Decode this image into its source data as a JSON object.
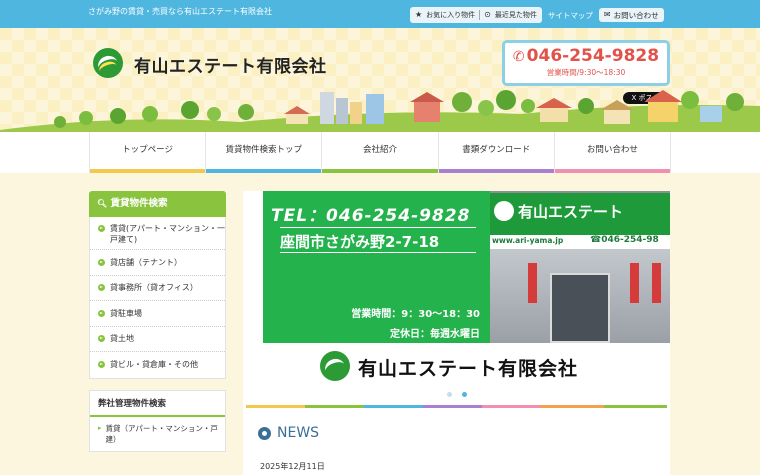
{
  "topbar": {
    "tagline": "さがみ野の賃貸・売買なら有山エステート有限会社",
    "favorites": "お気に入り物件",
    "recent": "最近見た物件",
    "sitemap": "サイトマップ",
    "contact": "お問い合わせ"
  },
  "header": {
    "company": "有山エステート有限会社",
    "phone": "046-254-9828",
    "hours": "営業時間/9:30〜18:30",
    "post_button": "X ポスト"
  },
  "nav": {
    "items": [
      {
        "label": "トップページ",
        "color": "#f2c94c"
      },
      {
        "label": "賃貸物件検索トップ",
        "color": "#4fb6e0"
      },
      {
        "label": "会社紹介",
        "color": "#8ac43f"
      },
      {
        "label": "書類ダウンロード",
        "color": "#a97fd0"
      },
      {
        "label": "お問い合わせ",
        "color": "#f08fb0"
      }
    ]
  },
  "sidebar": {
    "search_title": "賃貸物件検索",
    "items": [
      "賃貸(アパート・マンション・一戸建て)",
      "貸店舗（テナント）",
      "貸事務所（貸オフィス）",
      "貸駐車場",
      "貸土地",
      "貸ビル・貸倉庫・その他"
    ],
    "managed_title": "弊社管理物件検索",
    "managed_items": [
      "賃貸（アパート・マンション・戸建）"
    ]
  },
  "slide": {
    "tel": "TEL：046-254-9828",
    "address": "座間市さがみ野2-7-18",
    "hours": "営業時間：9：30〜18：30",
    "closed": "定休日：毎週水曜日",
    "sign_text": "有山エステート",
    "sign_url": "www.ari-yama.jp",
    "sign_tel": "☎046-254-98",
    "company": "有山エステート有限会社"
  },
  "news": {
    "title": "NEWS",
    "date": "2025年12月11日"
  },
  "colors": {
    "accent_blue": "#4fb6e0",
    "accent_green": "#8ac43f",
    "phone_red": "#e1524a"
  }
}
